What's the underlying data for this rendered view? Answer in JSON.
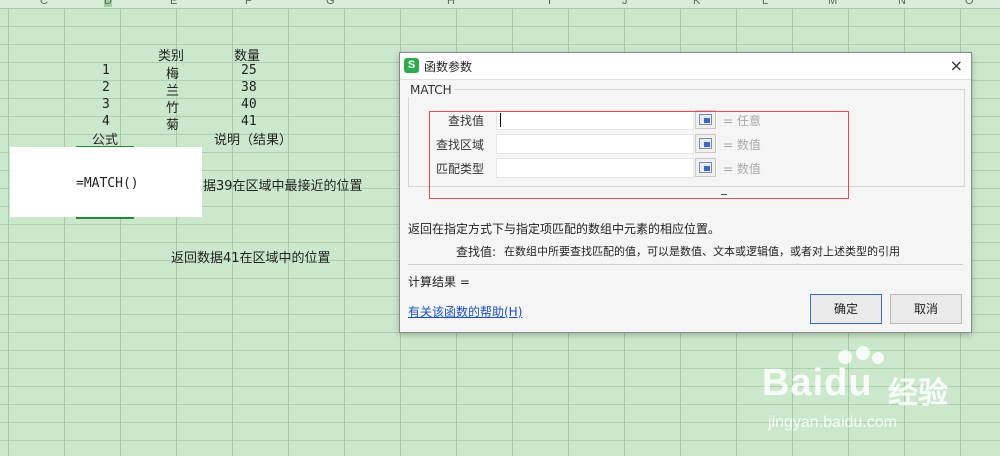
{
  "columns": [
    "C",
    "D",
    "E",
    "F",
    "G",
    "H",
    "I",
    "J",
    "K",
    "L",
    "M",
    "N",
    "O"
  ],
  "sheet": {
    "header_category": "类别",
    "header_quantity": "数量",
    "rows": [
      {
        "num": "1",
        "cat": "梅",
        "qty": "25"
      },
      {
        "num": "2",
        "cat": "兰",
        "qty": "38"
      },
      {
        "num": "3",
        "cat": "竹",
        "qty": "40"
      },
      {
        "num": "4",
        "cat": "菊",
        "qty": "41"
      }
    ],
    "formula_header": "公式",
    "explain_header": "说明（结果）",
    "active_formula": "=MATCH()",
    "explain_1": "据39在区域中最接近的位置",
    "explain_2": "返回数据41在区域中的位置"
  },
  "dialog": {
    "title": "函数参数",
    "app_icon_letter": "S",
    "close_label": "×",
    "function_name": "MATCH",
    "args": [
      {
        "label": "查找值",
        "value": "",
        "result": "= 任意"
      },
      {
        "label": "查找区域",
        "value": "",
        "result": "= 数值"
      },
      {
        "label": "匹配类型",
        "value": "",
        "result": "= 数值"
      }
    ],
    "description": "返回在指定方式下与指定项匹配的数组中元素的相应位置。",
    "arg_desc_label": "查找值:",
    "arg_desc": "在数组中所要查找匹配的值，可以是数值、文本或逻辑值，或者对上述类型的引用",
    "calc_result": "计算结果 =",
    "help_link": "有关该函数的帮助(H)",
    "ok_label": "确定",
    "cancel_label": "取消"
  },
  "watermark": {
    "brand": "Bai",
    "brand2": "du",
    "brand_cn": "经验",
    "url": "jingyan.baidu.com"
  }
}
